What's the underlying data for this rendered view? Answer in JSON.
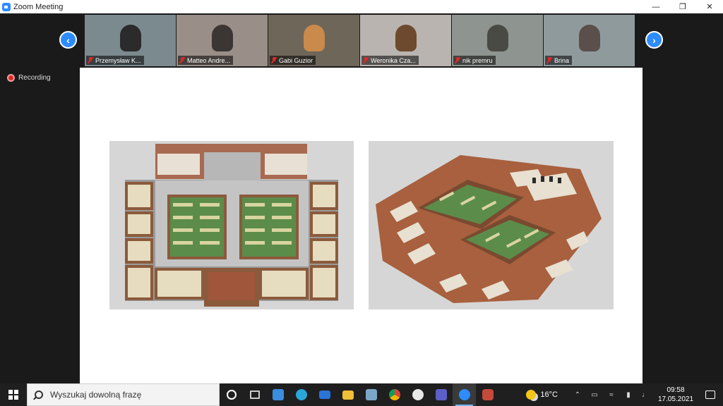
{
  "window": {
    "title": "Zoom Meeting"
  },
  "participants": [
    {
      "name": "Przemysław K...",
      "bg": "#7b8a8e",
      "person": "#2b2b2b"
    },
    {
      "name": "Matteo Andre...",
      "bg": "#9a8f88",
      "person": "#3b3534"
    },
    {
      "name": "Gabi Guzior",
      "bg": "#6e6659",
      "person": "#c98a4c"
    },
    {
      "name": "Weronika Cza...",
      "bg": "#b9b4b0",
      "person": "#6d4a2e"
    },
    {
      "name": "nik premru",
      "bg": "#8e948f",
      "person": "#4a4a44"
    },
    {
      "name": "Brina",
      "bg": "#8f9a9d",
      "person": "#5a4f4a"
    }
  ],
  "navigation": {
    "prev": "‹",
    "next": "›"
  },
  "recording": {
    "label": "Recording"
  },
  "taskbar": {
    "search_placeholder": "Wyszukaj dowolną frazę",
    "apps": [
      {
        "icon": "cortana-icon",
        "color": "#ffffff"
      },
      {
        "icon": "task-view-icon",
        "color": "#cccccc"
      },
      {
        "icon": "store-icon",
        "color": "#3b8de0"
      },
      {
        "icon": "edge-icon",
        "color": "#2aa6d8"
      },
      {
        "icon": "mail-icon",
        "color": "#2a74d8"
      },
      {
        "icon": "file-explorer-icon",
        "color": "#f2c037"
      },
      {
        "icon": "image-app-icon",
        "color": "#7aa7c7"
      },
      {
        "icon": "chrome-icon",
        "color": "#e5b433"
      },
      {
        "icon": "app-icon",
        "color": "#777777"
      },
      {
        "icon": "teams-icon",
        "color": "#5b5fc7"
      },
      {
        "icon": "zoom-icon",
        "color": "#2d8cff"
      },
      {
        "icon": "sketchup-icon",
        "color": "#c44a3b"
      }
    ],
    "temperature": "16°C",
    "time": "09:58",
    "date": "17.05.2021"
  }
}
